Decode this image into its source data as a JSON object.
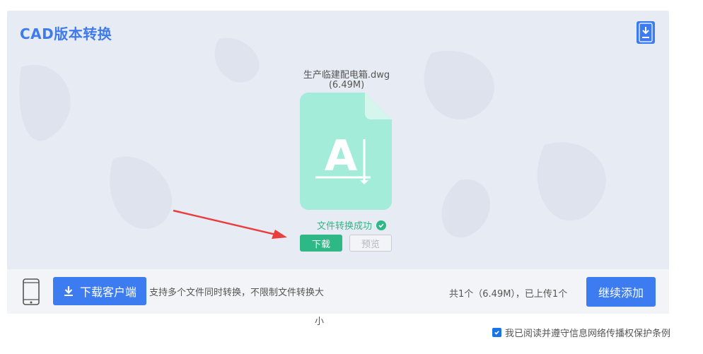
{
  "header": {
    "title": "CAD版本转换",
    "corner_icon": "download-app-icon"
  },
  "file": {
    "name": "生产临建配电箱.dwg",
    "size": "(6.49M)",
    "icon_letter": "A",
    "icon_color": "#a3ecd9",
    "status": "文件转换成功",
    "status_color": "#2eb886"
  },
  "actions": {
    "download_label": "下载",
    "preview_label": "预览"
  },
  "footer": {
    "client_button_label": "下载客户端",
    "tip_line1": "支持多个文件同时转换，不限制文件转换大",
    "tip_line2": "小",
    "count_text": "共1个（6.49M），已上传1个",
    "continue_label": "继续添加"
  },
  "agreement": {
    "text": "我已阅读并遵守信息网络传播权保护条例",
    "checked": true
  },
  "colors": {
    "accent": "#3c7bf0",
    "success": "#2eb886",
    "panel_bg": "#e7ebf3"
  }
}
